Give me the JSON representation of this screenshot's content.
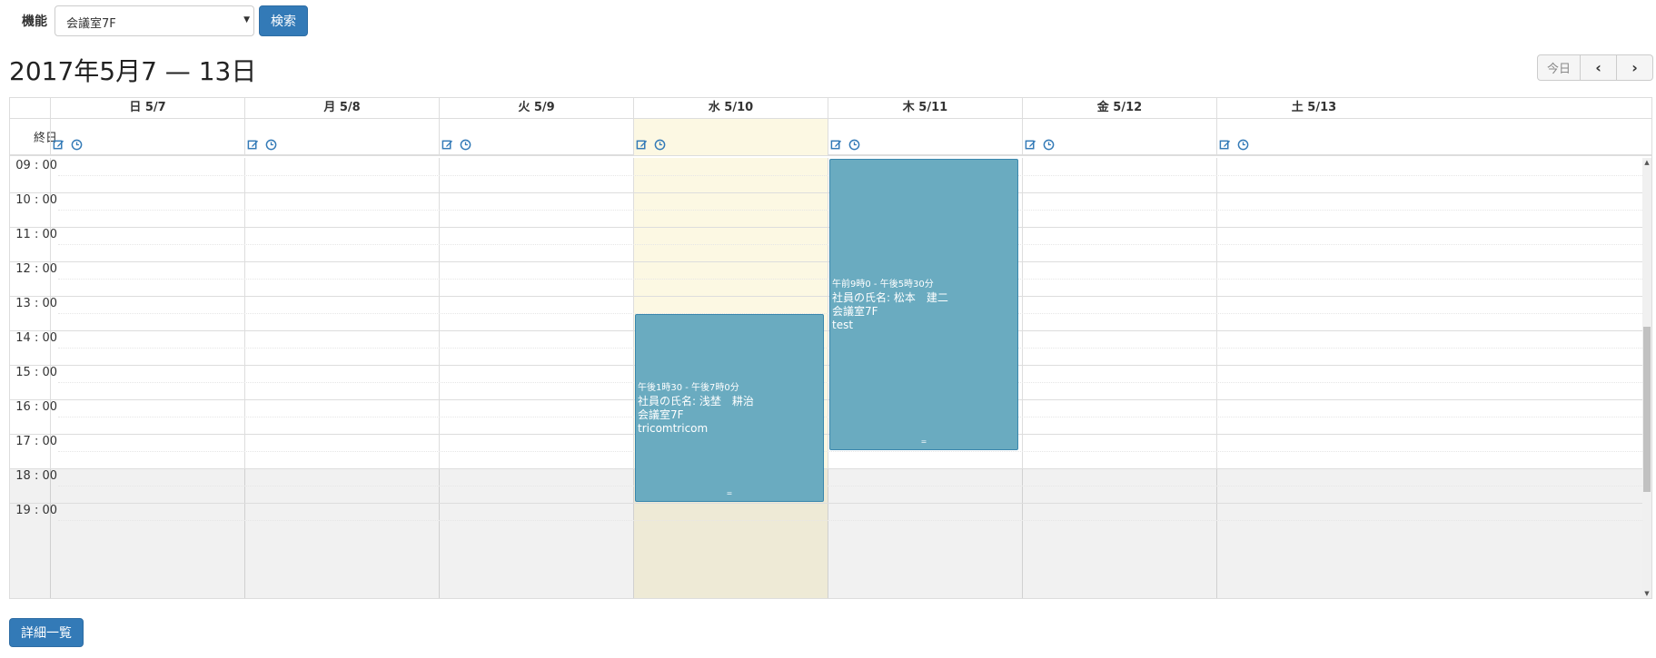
{
  "search": {
    "label": "機能",
    "selected": "会議室7F",
    "button": "検索"
  },
  "title": "2017年5月7 — 13日",
  "nav": {
    "today": "今日",
    "prev": "‹",
    "next": "›"
  },
  "calendar": {
    "days": [
      {
        "label": "日 5/7"
      },
      {
        "label": "月 5/8"
      },
      {
        "label": "火 5/9"
      },
      {
        "label": "水 5/10",
        "today": true
      },
      {
        "label": "木 5/11"
      },
      {
        "label": "金 5/12"
      },
      {
        "label": "土 5/13"
      }
    ],
    "allday_label": "終日",
    "hours": [
      "09 : 00",
      "10 : 00",
      "11 : 00",
      "12 : 00",
      "13 : 00",
      "14 : 00",
      "15 : 00",
      "16 : 00",
      "17 : 00",
      "18 : 00",
      "19 : 00"
    ],
    "events": [
      {
        "day": 3,
        "start": 13.5,
        "end": 19.0,
        "time": "午後1時30 - 午後7時0分",
        "employee": "社員の氏名: 浅埜　耕治",
        "room": "会議室7F",
        "note": "tricomtricom"
      },
      {
        "day": 4,
        "start": 9.0,
        "end": 17.5,
        "time": "午前9時0 - 午後5時30分",
        "employee": "社員の氏名: 松本　建二",
        "room": "会議室7F",
        "note": "test"
      }
    ]
  },
  "footer": {
    "detail_button": "詳細一覧"
  },
  "colors": {
    "primary": "#337ab7",
    "event": "#6aabc0",
    "today": "#fcf8e3"
  }
}
